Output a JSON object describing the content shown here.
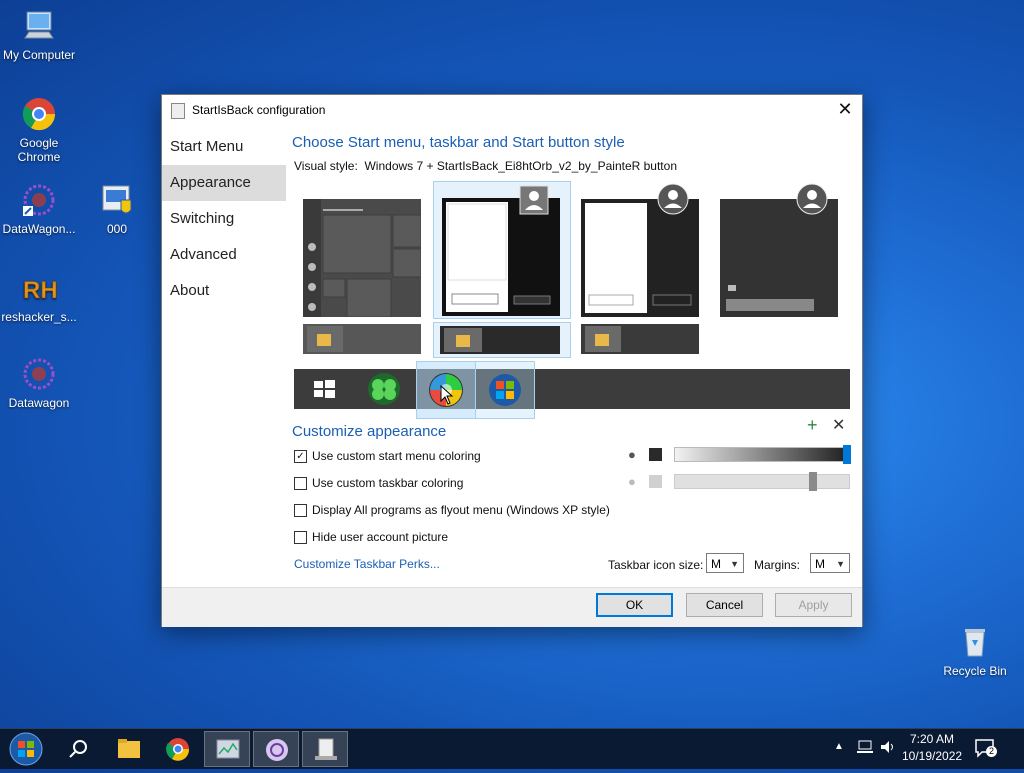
{
  "desktop": {
    "icons": [
      {
        "label": "My Computer",
        "icon": "computer-icon"
      },
      {
        "label": "Google Chrome",
        "icon": "chrome-icon"
      },
      {
        "label": "DataWagon...",
        "icon": "datawagon-shortcut-icon"
      },
      {
        "label": "000",
        "icon": "shield-app-icon"
      },
      {
        "label": "reshacker_s...",
        "icon": "reshacker-icon"
      },
      {
        "label": "Datawagon",
        "icon": "datawagon-icon"
      },
      {
        "label": "Recycle Bin",
        "icon": "recycle-bin-icon"
      }
    ]
  },
  "dialog": {
    "title": "StartIsBack configuration",
    "nav": [
      "Start Menu",
      "Appearance",
      "Switching",
      "Advanced",
      "About"
    ],
    "active_nav": "Appearance",
    "heading_style": "Choose Start menu, taskbar and Start button style",
    "visual_style_label": "Visual style:",
    "visual_style_value": "Windows 7 + StartIsBack_Ei8htOrb_v2_by_PainteR button",
    "heading_customize": "Customize appearance",
    "options": [
      {
        "label": "Use custom start menu coloring",
        "checked": true
      },
      {
        "label": "Use custom taskbar coloring",
        "checked": false
      },
      {
        "label": "Display All programs as flyout menu (Windows XP style)",
        "checked": false
      },
      {
        "label": "Hide user account picture",
        "checked": false
      }
    ],
    "link": "Customize Taskbar Perks...",
    "taskbar_icon_size_label": "Taskbar icon size:",
    "taskbar_icon_size_value": "M",
    "margins_label": "Margins:",
    "margins_value": "M",
    "ok": "OK",
    "cancel": "Cancel",
    "apply": "Apply",
    "start_menu_slider": 1.0,
    "taskbar_slider": 0.8,
    "start_menu_swatch": "#2a2a2a",
    "taskbar_swatch": "#d0d0d0"
  },
  "tray": {
    "time": "7:20 AM",
    "date": "10/19/2022",
    "notifications": "2"
  },
  "colors": {
    "accent": "#1a5fb4",
    "selection": "#e6f2fb"
  }
}
